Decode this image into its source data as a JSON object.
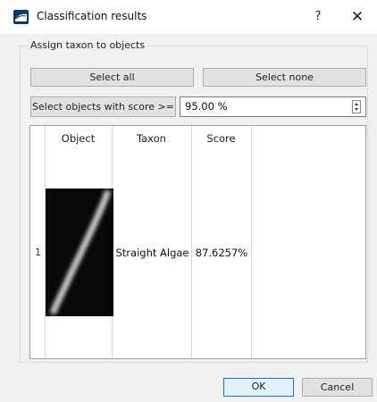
{
  "window": {
    "title": "Classification results",
    "help_glyph": "?",
    "close_glyph": "✕"
  },
  "group": {
    "title": "Assign taxon to objects"
  },
  "buttons": {
    "select_all": "Select all",
    "select_none": "Select none",
    "select_by_score": "Select objects with score >=",
    "ok": "OK",
    "cancel": "Cancel"
  },
  "score_spinbox": {
    "value": "95.00 %"
  },
  "table": {
    "headers": [
      "Object",
      "Taxon",
      "Score"
    ],
    "rows": [
      {
        "row_number": "1",
        "taxon": "Straight Algae",
        "score": "87.6257%"
      }
    ]
  },
  "colors": {
    "dialog_bg": "#f0f0f0",
    "titlebar_bg": "#ffffff",
    "button_bg": "#e1e1e1",
    "default_button_border": "#0078d7",
    "app_icon": "#0b3a66"
  },
  "icons": {
    "app": "app-logo-icon",
    "help": "help-icon",
    "close": "close-icon",
    "spin_up": "arrow-up-icon",
    "spin_down": "arrow-down-icon"
  }
}
